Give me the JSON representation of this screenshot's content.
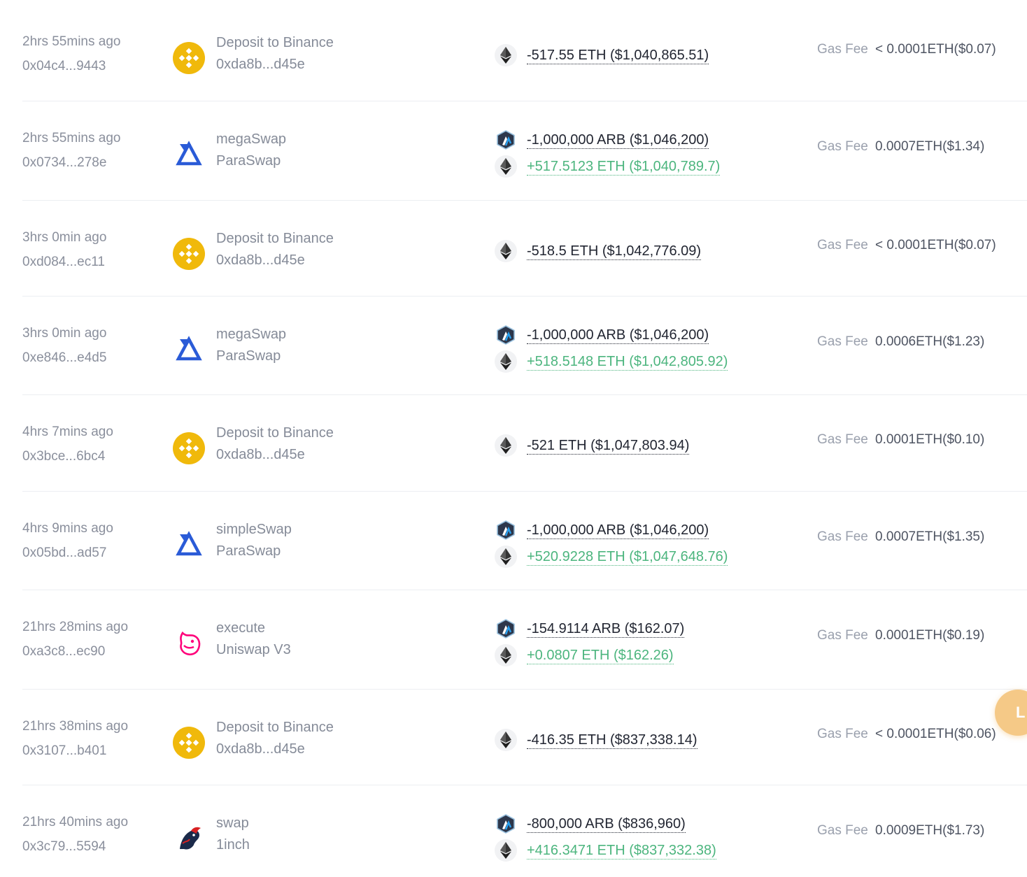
{
  "transactions": [
    {
      "time": "2hrs 55mins ago",
      "hash": "0x04c4...9443",
      "method": "Deposit to Binance",
      "protocol": "0xda8b...d45e",
      "icon": "binance-icon",
      "amounts": [
        {
          "token": "eth",
          "text": "-517.55 ETH ($1,040,865.51)",
          "dir": "out"
        }
      ],
      "gas_label": "Gas Fee",
      "gas": "< 0.0001ETH($0.07)"
    },
    {
      "time": "2hrs 55mins ago",
      "hash": "0x0734...278e",
      "method": "megaSwap",
      "protocol": "ParaSwap",
      "icon": "paraswap-icon",
      "amounts": [
        {
          "token": "arb",
          "text": "-1,000,000 ARB ($1,046,200)",
          "dir": "out"
        },
        {
          "token": "eth",
          "text": "+517.5123 ETH ($1,040,789.7)",
          "dir": "in"
        }
      ],
      "gas_label": "Gas Fee",
      "gas": "0.0007ETH($1.34)"
    },
    {
      "time": "3hrs 0min ago",
      "hash": "0xd084...ec11",
      "method": "Deposit to Binance",
      "protocol": "0xda8b...d45e",
      "icon": "binance-icon",
      "amounts": [
        {
          "token": "eth",
          "text": "-518.5 ETH ($1,042,776.09)",
          "dir": "out"
        }
      ],
      "gas_label": "Gas Fee",
      "gas": "< 0.0001ETH($0.07)"
    },
    {
      "time": "3hrs 0min ago",
      "hash": "0xe846...e4d5",
      "method": "megaSwap",
      "protocol": "ParaSwap",
      "icon": "paraswap-icon",
      "amounts": [
        {
          "token": "arb",
          "text": "-1,000,000 ARB ($1,046,200)",
          "dir": "out"
        },
        {
          "token": "eth",
          "text": "+518.5148 ETH ($1,042,805.92)",
          "dir": "in"
        }
      ],
      "gas_label": "Gas Fee",
      "gas": "0.0006ETH($1.23)"
    },
    {
      "time": "4hrs 7mins ago",
      "hash": "0x3bce...6bc4",
      "method": "Deposit to Binance",
      "protocol": "0xda8b...d45e",
      "icon": "binance-icon",
      "amounts": [
        {
          "token": "eth",
          "text": "-521 ETH ($1,047,803.94)",
          "dir": "out"
        }
      ],
      "gas_label": "Gas Fee",
      "gas": "0.0001ETH($0.10)"
    },
    {
      "time": "4hrs 9mins ago",
      "hash": "0x05bd...ad57",
      "method": "simpleSwap",
      "protocol": "ParaSwap",
      "icon": "paraswap-icon",
      "amounts": [
        {
          "token": "arb",
          "text": "-1,000,000 ARB ($1,046,200)",
          "dir": "out"
        },
        {
          "token": "eth",
          "text": "+520.9228 ETH ($1,047,648.76)",
          "dir": "in"
        }
      ],
      "gas_label": "Gas Fee",
      "gas": "0.0007ETH($1.35)"
    },
    {
      "time": "21hrs 28mins ago",
      "hash": "0xa3c8...ec90",
      "method": "execute",
      "protocol": "Uniswap V3",
      "icon": "uniswap-icon",
      "amounts": [
        {
          "token": "arb",
          "text": "-154.9114 ARB ($162.07)",
          "dir": "out"
        },
        {
          "token": "eth",
          "text": "+0.0807 ETH ($162.26)",
          "dir": "in"
        }
      ],
      "gas_label": "Gas Fee",
      "gas": "0.0001ETH($0.19)"
    },
    {
      "time": "21hrs 38mins ago",
      "hash": "0x3107...b401",
      "method": "Deposit to Binance",
      "protocol": "0xda8b...d45e",
      "icon": "binance-icon",
      "amounts": [
        {
          "token": "eth",
          "text": "-416.35 ETH ($837,338.14)",
          "dir": "out"
        }
      ],
      "gas_label": "Gas Fee",
      "gas": "< 0.0001ETH($0.06)"
    },
    {
      "time": "21hrs 40mins ago",
      "hash": "0x3c79...5594",
      "method": "swap",
      "protocol": "1inch",
      "icon": "1inch-icon",
      "amounts": [
        {
          "token": "arb",
          "text": "-800,000 ARB ($836,960)",
          "dir": "out"
        },
        {
          "token": "eth",
          "text": "+416.3471 ETH ($837,332.38)",
          "dir": "in"
        }
      ],
      "gas_label": "Gas Fee",
      "gas": "0.0009ETH($1.73)"
    }
  ],
  "floating_button": {
    "label": "L",
    "icon": "chat-icon"
  },
  "colors": {
    "out": "#222632",
    "in": "#4cb57e",
    "binance": "#f0b90b",
    "paraswap": "#2a5bd7",
    "uniswap": "#ff007a",
    "arb_bg": "#2d374b"
  }
}
